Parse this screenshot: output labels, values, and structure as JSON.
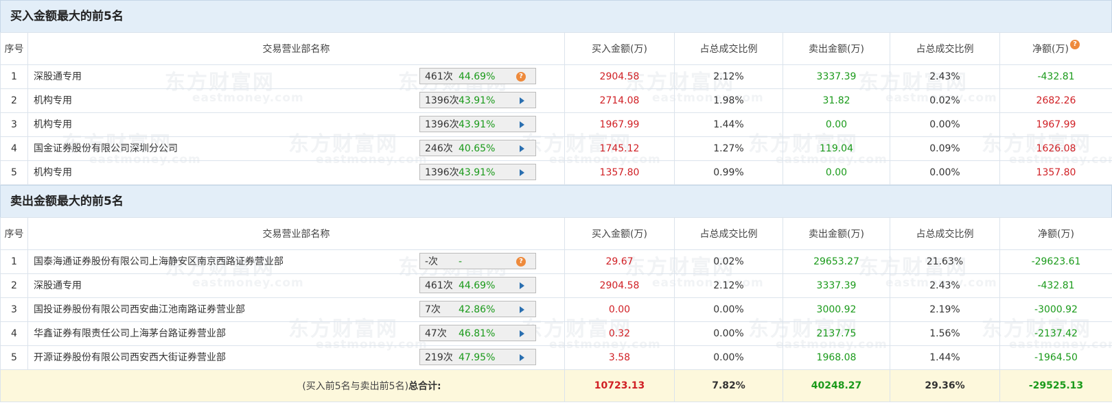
{
  "watermark": {
    "brand": "东方财富网",
    "domain": "eastmoney.com"
  },
  "buy_section": {
    "title": "买入金额最大的前5名",
    "headers": {
      "seq": "序号",
      "name": "交易营业部名称",
      "buy": "买入金额(万)",
      "buy_ratio": "占总成交比例",
      "sell": "卖出金额(万)",
      "sell_ratio": "占总成交比例",
      "net": "净额(万)"
    },
    "rows": [
      {
        "seq": "1",
        "name": "深股通专用",
        "count": "461次",
        "pct": "44.69%",
        "icon": "question-icon",
        "buy": "2904.58",
        "buy_ratio": "2.12%",
        "sell": "3337.39",
        "sell_ratio": "2.43%",
        "net": "-432.81"
      },
      {
        "seq": "2",
        "name": "机构专用",
        "count": "1396次",
        "pct": "43.91%",
        "icon": "play-arrow-icon",
        "buy": "2714.08",
        "buy_ratio": "1.98%",
        "sell": "31.82",
        "sell_ratio": "0.02%",
        "net": "2682.26"
      },
      {
        "seq": "3",
        "name": "机构专用",
        "count": "1396次",
        "pct": "43.91%",
        "icon": "play-arrow-icon",
        "buy": "1967.99",
        "buy_ratio": "1.44%",
        "sell": "0.00",
        "sell_ratio": "0.00%",
        "net": "1967.99"
      },
      {
        "seq": "4",
        "name": "国金证券股份有限公司深圳分公司",
        "count": "246次",
        "pct": "40.65%",
        "icon": "play-arrow-icon",
        "buy": "1745.12",
        "buy_ratio": "1.27%",
        "sell": "119.04",
        "sell_ratio": "0.09%",
        "net": "1626.08"
      },
      {
        "seq": "5",
        "name": "机构专用",
        "count": "1396次",
        "pct": "43.91%",
        "icon": "play-arrow-icon",
        "buy": "1357.80",
        "buy_ratio": "0.99%",
        "sell": "0.00",
        "sell_ratio": "0.00%",
        "net": "1357.80"
      }
    ]
  },
  "sell_section": {
    "title": "卖出金额最大的前5名",
    "headers": {
      "seq": "序号",
      "name": "交易营业部名称",
      "buy": "买入金额(万)",
      "buy_ratio": "占总成交比例",
      "sell": "卖出金额(万)",
      "sell_ratio": "占总成交比例",
      "net": "净额(万)"
    },
    "rows": [
      {
        "seq": "1",
        "name": "国泰海通证券股份有限公司上海静安区南京西路证券营业部",
        "count": "-次",
        "pct": "-",
        "icon": "question-icon",
        "buy": "29.67",
        "buy_ratio": "0.02%",
        "sell": "29653.27",
        "sell_ratio": "21.63%",
        "net": "-29623.61"
      },
      {
        "seq": "2",
        "name": "深股通专用",
        "count": "461次",
        "pct": "44.69%",
        "icon": "play-arrow-icon",
        "buy": "2904.58",
        "buy_ratio": "2.12%",
        "sell": "3337.39",
        "sell_ratio": "2.43%",
        "net": "-432.81"
      },
      {
        "seq": "3",
        "name": "国投证券股份有限公司西安曲江池南路证券营业部",
        "count": "7次",
        "pct": "42.86%",
        "icon": "play-arrow-icon",
        "buy": "0.00",
        "buy_ratio": "0.00%",
        "sell": "3000.92",
        "sell_ratio": "2.19%",
        "net": "-3000.92"
      },
      {
        "seq": "4",
        "name": "华鑫证券有限责任公司上海茅台路证券营业部",
        "count": "47次",
        "pct": "46.81%",
        "icon": "play-arrow-icon",
        "buy": "0.32",
        "buy_ratio": "0.00%",
        "sell": "2137.75",
        "sell_ratio": "1.56%",
        "net": "-2137.42"
      },
      {
        "seq": "5",
        "name": "开源证券股份有限公司西安西大街证券营业部",
        "count": "219次",
        "pct": "47.95%",
        "icon": "play-arrow-icon",
        "buy": "3.58",
        "buy_ratio": "0.00%",
        "sell": "1968.08",
        "sell_ratio": "1.44%",
        "net": "-1964.50"
      }
    ]
  },
  "total": {
    "label_prefix": "(买入前5名与卖出前5名)",
    "label_bold": "总合计:",
    "buy": "10723.13",
    "buy_ratio": "7.82%",
    "sell": "40248.27",
    "sell_ratio": "29.36%",
    "net": "-29525.13"
  },
  "colors": {
    "positive": "#d01f24",
    "negative": "#1a9a1a",
    "header_bg": "#e3eef8",
    "total_bg": "#fdf8dc"
  }
}
